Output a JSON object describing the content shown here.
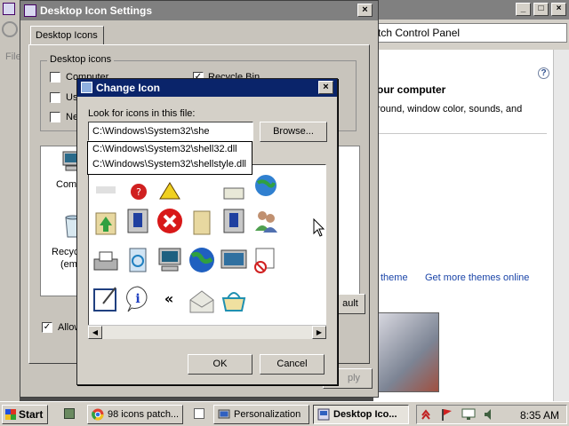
{
  "personalization": {
    "address": "tch Control Panel",
    "heading": "our computer",
    "description": "round, window color, sounds, and",
    "link_theme": "theme",
    "link_more_themes": "Get more themes online",
    "help_glyph": "?",
    "title_buttons": [
      "_",
      "□",
      "×"
    ]
  },
  "desktop_icon_settings": {
    "title": "Desktop Icon Settings",
    "tab": "Desktop Icons",
    "group_label": "Desktop icons",
    "checkboxes": [
      {
        "label": "Computer",
        "checked": false
      },
      {
        "label": "Us",
        "checked": false
      },
      {
        "label": "Ne",
        "checked": false
      },
      {
        "label": "Recycle Bin",
        "checked": true
      }
    ],
    "icon_labels": [
      "Comp",
      "Recyc",
      "(em"
    ],
    "left_fragment": "File",
    "allow_label": "Allow",
    "allow_checked": true,
    "restore_default_fragment": "ault",
    "apply_fragment": "ply",
    "close_glyph": "×"
  },
  "change_icon": {
    "title": "Change Icon",
    "look_label": "Look for icons in this file:",
    "path_value": "C:\\Windows\\System32\\she",
    "browse_label": "Browse...",
    "suggestions": [
      "C:\\Windows\\System32\\shell32.dll",
      "C:\\Windows\\System32\\shellstyle.dll"
    ],
    "ok_label": "OK",
    "cancel_label": "Cancel",
    "close_glyph": "×",
    "scroll_left": "◀",
    "scroll_right": "▶"
  },
  "taskbar": {
    "start_label": "Start",
    "buttons": [
      {
        "label": "98 icons patch...",
        "icon": "chrome-icon",
        "active": false
      },
      {
        "label": "Personalization",
        "icon": "personalization-icon",
        "active": false
      },
      {
        "label": "Desktop Ico...",
        "icon": "desktop-icon",
        "active": true
      }
    ],
    "clock": "8:35 AM"
  },
  "colors": {
    "titlebar_active": "#0a246a",
    "titlebar_inactive": "#808080",
    "face": "#d4d0c8",
    "link": "#1a44a8"
  }
}
